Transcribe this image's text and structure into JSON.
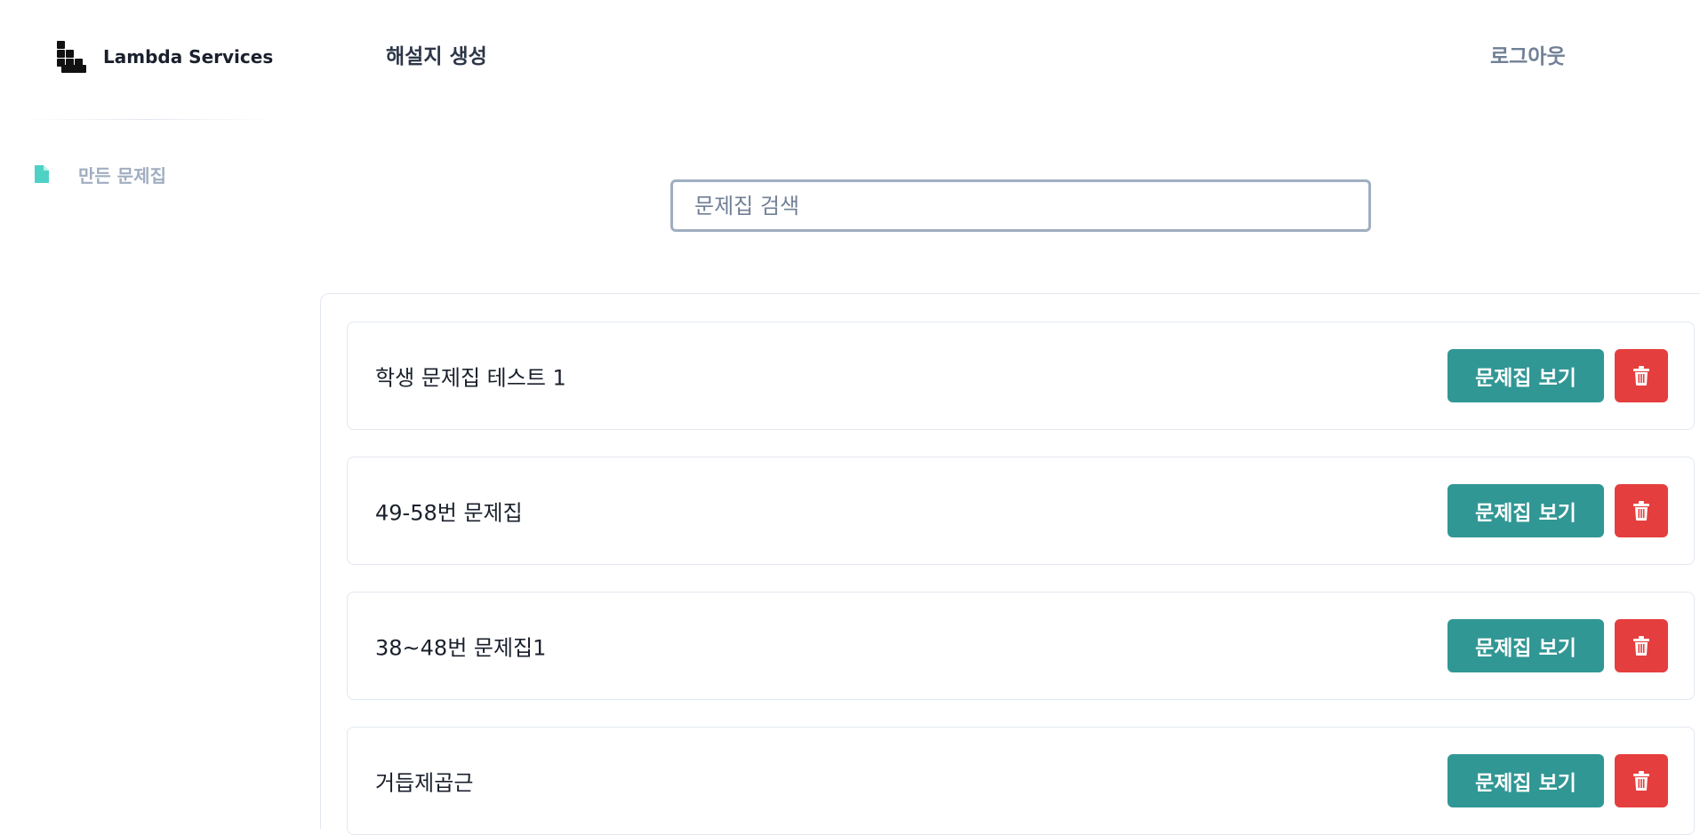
{
  "app": {
    "brand": "Lambda Services"
  },
  "sidebar": {
    "items": [
      {
        "label": "만든 문제집",
        "icon": "document-icon"
      }
    ]
  },
  "header": {
    "title": "해설지 생성",
    "logout_label": "로그아웃"
  },
  "search": {
    "placeholder": "문제집 검색",
    "value": ""
  },
  "workbooks": [
    {
      "title": "학생 문제집 테스트 1",
      "view_label": "문제집 보기"
    },
    {
      "title": "49-58번 문제집",
      "view_label": "문제집 보기"
    },
    {
      "title": "38~48번 문제집1",
      "view_label": "문제집 보기"
    },
    {
      "title": "거듭제곱근",
      "view_label": "문제집 보기"
    }
  ],
  "colors": {
    "accent_teal": "#319795",
    "danger_red": "#e53e3e",
    "sidebar_icon": "#4fd1c5",
    "muted_text": "#a0aec0"
  },
  "icons": {
    "logo": "lambda-logo-icon",
    "delete": "trash-icon"
  }
}
